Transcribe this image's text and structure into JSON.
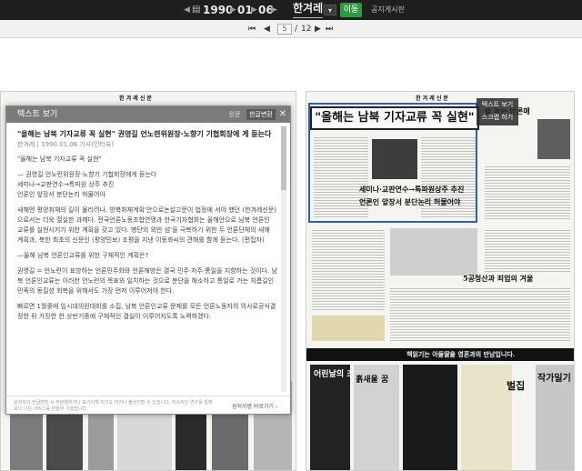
{
  "topbar": {
    "prev_year": "◀",
    "year": "1990",
    "next_year": "▶",
    "month": "01",
    "day": "06",
    "day_next": "▶",
    "newspaper": "한겨레",
    "move_button": "이동",
    "notice": "공지게시판"
  },
  "pager": {
    "first": "⏮",
    "prev": "◀",
    "current_page": "5",
    "separator": "/",
    "total_pages": "12",
    "next": "▶",
    "last": "⏭"
  },
  "text_panel": {
    "title": "텍스트 보기",
    "btn_original": "원문",
    "btn_hangul": "한글변환",
    "close": "✕",
    "article_title": "\"올해는 남북 기자교류 꼭 실현\" 권영길 언노련위원장·노향기 기협회장에 게 듣는다",
    "article_meta": "한겨레 | 1990.01.06 기사(인터뷰)",
    "paragraphs": [
      "\"올해는 남북 기자교류 꼭 실현\"",
      "",
      "— 권영길 언노련위원장·노향기 기협회장에게 듣는다",
      "세미나→교판연수→특파원 상주 추진",
      "언론인 앞장서 분단논리 허물어야",
      "",
      "새해엔 평양취재의 길이 몰리려나. 방북취재계획'안으로논설고문이 법정에 서야 했던 (한겨레신문) 으로서는 더욱 절실한 과제다. 전국언론노동조합연맹과 한국기자협회는 올해안으로 남북 언론인 교류를 실현시키기 위한 계획을 갖고 있다. 병단의 외만 섬'을 극복하기 위한 두 언론단체의 새해 계획과, 북한 최초의 신문인 (평양민보) 조평을 지낸 이동화씨의 견해를 함께 듣는다. (편집자)",
      "",
      "—올해 남북 언론인교류를 위한 구체적인 계획은?",
      "",
      "권영길 = 언노련이 표방하는 언론민주화와 언론해방은 결국 민주·자주·통일을 지향하는 것이다. 남북 언론인교류는 이러한 언노련의 목표와 일치하는 것으로 분단을 해소하고 통일로 가는 지름길인 민족의 동질성 회복을 위해서도 가장 먼저 이루어져야 한다.",
      "",
      "빠르면 1월중에 임시대의원대회를 소집, 남북 언론인교류 문제를 모든 언론노동자의 의사로공식결정한 뒤 가장한 한 상반기중에 구체적인 결실이 이루어지도록 노력하겠다."
    ],
    "footer_left": "원저자의 한글변환 시 무분별하거나 표기이해 되기도 하거나 불완전할 수 있습니다. 지속적인 연구를 통해 보다 나은 서비스를 만들어 가겠습니다.",
    "footer_right": "원저자명 바로가기 ›"
  },
  "overlay": {
    "text_view": "텍스트 보기",
    "scrap": "스크랩 하기"
  },
  "newspaper": {
    "masthead": "한 겨 레 신 문",
    "main_headline": "\"올해는 남북 기자교류 꼭 실현\"",
    "subhead_1": "세미나·교판연수→특파원상주 추진",
    "subhead_2": "언론인 앞장서 분단논리 허물어야",
    "side_headline": "을 높는 언론매",
    "mid_headline": "5공청산과 죄업의 겨울",
    "bottom_headline": "책읽기는 아들딸을 영혼과의 만남입니다.",
    "ad_1": "어린날의 초상",
    "ad_2": "흙새울 꿈",
    "ad_3": "벌집",
    "ad_4": "작가일기"
  }
}
